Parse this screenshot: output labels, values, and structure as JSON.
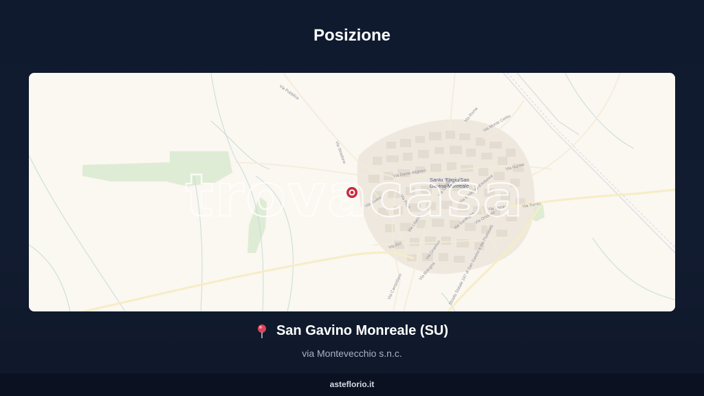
{
  "header": {
    "title": "Posizione"
  },
  "map": {
    "watermark": "trovacasa",
    "town_label_line1": "Santu 'Engiu/San",
    "town_label_line2": "Gavino Monreale",
    "streets": {
      "pubblica": "Via Pubblica",
      "stradone": "Via Stradone",
      "dante": "Via Dante Alighieri",
      "monte_cerbu": "Via Monte Cerbu",
      "roma": "Via Roma",
      "nuraxi": "Via Nuraxi",
      "trento": "Via Trento",
      "trento_2": "Via Trento",
      "eleonora": "Via Eleonora d'Arborea",
      "tuveri": "Via Tuveri",
      "friuli": "Via Friuli",
      "libertà": "Via Libertà",
      "rio": "Via Rio",
      "gramsci": "Via Gramsci",
      "campidano": "Via Campidano",
      "statale": "Strada Statale 197 di San Gavino e dei Fluminesi",
      "bologna": "Via Bologna",
      "sardegna": "Via Sardegna",
      "oristano": "Via Oristano",
      "cagliari": "Via Cagliari"
    }
  },
  "location": {
    "name": "San Gavino Monreale (SU)",
    "address": "via Montevecchio s.n.c."
  },
  "footer": {
    "site": "asteflorio.it"
  }
}
